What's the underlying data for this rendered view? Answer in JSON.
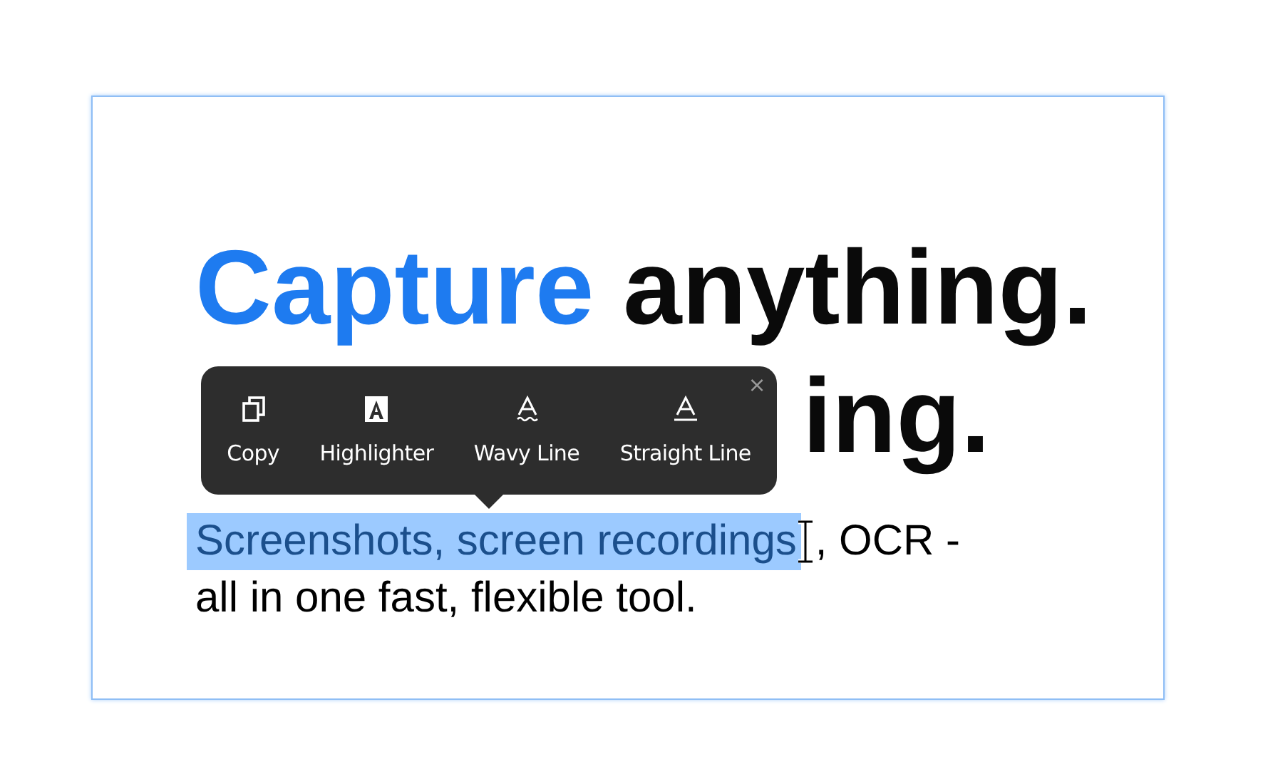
{
  "heading": {
    "highlight": "Capture",
    "rest": "anything.",
    "line_2_visible": "ing."
  },
  "toolbar": {
    "close": "×",
    "buttons": [
      {
        "kind": "copy",
        "label": "Copy"
      },
      {
        "kind": "highlighter",
        "label": "Highlighter"
      },
      {
        "kind": "wavy",
        "label": "Wavy Line"
      },
      {
        "kind": "straight",
        "label": "Straight Line"
      }
    ]
  },
  "paragraph": {
    "lines": [
      [
        {
          "text": "Screenshots, screen recordings",
          "selected": true
        },
        {
          "text": ", OCR -",
          "selected": false
        }
      ],
      [
        {
          "text": "all in one fast, flexible tool.",
          "selected": false
        }
      ]
    ]
  }
}
